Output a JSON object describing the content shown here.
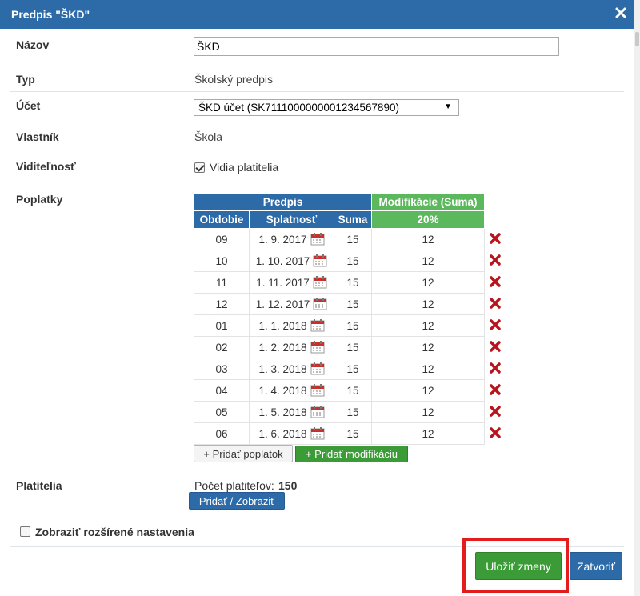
{
  "dialog": {
    "title": "Predpis \"ŠKD\""
  },
  "form": {
    "name_label": "Názov",
    "name_value": "ŠKD",
    "type_label": "Typ",
    "type_value": "Školský predpis",
    "account_label": "Účet",
    "account_value": "ŠKD účet (SK7111000000001234567890)",
    "owner_label": "Vlastník",
    "owner_value": "Škola",
    "visibility_label": "Viditeľnosť",
    "visibility_checkbox_label": "Vidia platitelia",
    "visibility_checked": true,
    "fees_label": "Poplatky",
    "payers_label": "Platitelia",
    "payers_count_label": "Počet platiteľov:",
    "payers_count": "150",
    "advanced_label": "Zobraziť rozšírené nastavenia"
  },
  "fees_table": {
    "group_predpis": "Predpis",
    "group_modifications": "Modifikácie (Suma)",
    "col_period": "Obdobie",
    "col_due": "Splatnosť",
    "col_amount": "Suma",
    "col_modification": "20%",
    "rows": [
      {
        "period": "09",
        "due": "1. 9. 2017",
        "amount": "15",
        "mod": "12"
      },
      {
        "period": "10",
        "due": "1. 10. 2017",
        "amount": "15",
        "mod": "12"
      },
      {
        "period": "11",
        "due": "1. 11. 2017",
        "amount": "15",
        "mod": "12"
      },
      {
        "period": "12",
        "due": "1. 12. 2017",
        "amount": "15",
        "mod": "12"
      },
      {
        "period": "01",
        "due": "1. 1. 2018",
        "amount": "15",
        "mod": "12"
      },
      {
        "period": "02",
        "due": "1. 2. 2018",
        "amount": "15",
        "mod": "12"
      },
      {
        "period": "03",
        "due": "1. 3. 2018",
        "amount": "15",
        "mod": "12"
      },
      {
        "period": "04",
        "due": "1. 4. 2018",
        "amount": "15",
        "mod": "12"
      },
      {
        "period": "05",
        "due": "1. 5. 2018",
        "amount": "15",
        "mod": "12"
      },
      {
        "period": "06",
        "due": "1. 6. 2018",
        "amount": "15",
        "mod": "12"
      }
    ]
  },
  "buttons": {
    "add_fee": "+ Pridať poplatok",
    "add_modification": "+ Pridať modifikáciu",
    "add_show_payers": "Pridať / Zobraziť",
    "save": "Uložiť zmeny",
    "close": "Zatvoriť"
  },
  "icons": {
    "close": "close-icon",
    "calendar": "calendar-icon",
    "delete": "delete-icon",
    "dropdown": "chevron-down-icon"
  },
  "colors": {
    "primary": "#2d6aa8",
    "success": "#3a9b37",
    "header_green": "#5cb85c",
    "delete_red": "#b8141b",
    "highlight": "#e41c1c"
  }
}
